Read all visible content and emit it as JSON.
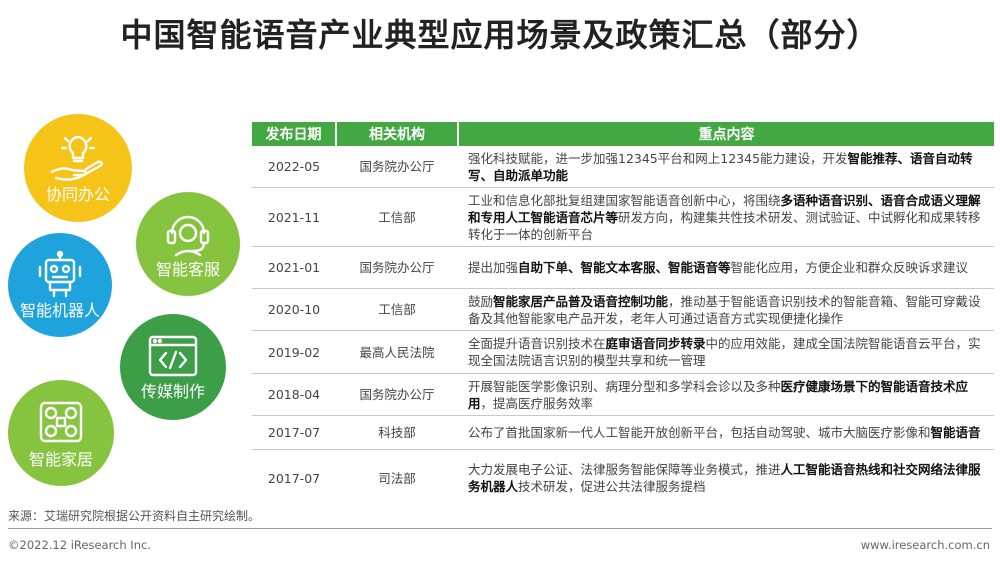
{
  "title": "中国智能语音产业典型应用场景及政策汇总（部分）",
  "scenarios": [
    {
      "label": "协同办公",
      "icon": "lightbulb-hand-icon",
      "color": "#f6c319"
    },
    {
      "label": "智能客服",
      "icon": "headset-agent-icon",
      "color": "#86c440"
    },
    {
      "label": "智能机器人",
      "icon": "robot-icon",
      "color": "#1fa3dc"
    },
    {
      "label": "传媒制作",
      "icon": "code-window-icon",
      "color": "#3c9e46"
    },
    {
      "label": "智能家居",
      "icon": "smart-home-icon",
      "color": "#86c440"
    }
  ],
  "table": {
    "headers": [
      "发布日期",
      "相关机构",
      "重点内容"
    ],
    "header_color": "#43a843",
    "rows": [
      {
        "date": "2022-05",
        "org": "国务院办公厅",
        "content": [
          [
            "强化科技赋能，进一步加强12345平台和网上12345能力建设，开发",
            false
          ],
          [
            "智能推荐、语音自动转写、自助派单功能",
            true
          ]
        ]
      },
      {
        "date": "2021-11",
        "org": "工信部",
        "content": [
          [
            "工业和信息化部批复组建国家智能语音创新中心，将围绕",
            false
          ],
          [
            "多语种语音识别、语音合成语义理解和专用人工智能语音芯片等",
            true
          ],
          [
            "研发方向，构建集共性技术研发、测试验证、中试孵化和成果转移转化于一体的创新平台",
            false
          ]
        ]
      },
      {
        "date": "2021-01",
        "org": "国务院办公厅",
        "content": [
          [
            "提出加强",
            false
          ],
          [
            "自助下单、智能文本客服、智能语音等",
            true
          ],
          [
            "智能化应用，方便企业和群众反映诉求建议",
            false
          ]
        ]
      },
      {
        "date": "2020-10",
        "org": "工信部",
        "content": [
          [
            "鼓励",
            false
          ],
          [
            "智能家居产品普及语音控制功能",
            true
          ],
          [
            "，推动基于智能语音识别技术的智能音箱、智能可穿戴设备及其他智能家电产品开发，老年人可通过语音方式实现便捷化操作",
            false
          ]
        ]
      },
      {
        "date": "2019-02",
        "org": "最高人民法院",
        "content": [
          [
            "全面提升语音识别技术在",
            false
          ],
          [
            "庭审语音同步转录",
            true
          ],
          [
            "中的应用效能，建成全国法院智能语音云平台，实现全国法院语言识别的模型共享和统一管理",
            false
          ]
        ]
      },
      {
        "date": "2018-04",
        "org": "国务院办公厅",
        "content": [
          [
            "开展智能医学影像识别、病理分型和多学科会诊以及多种",
            false
          ],
          [
            "医疗健康场景下的智能语音技术应用",
            true
          ],
          [
            "，提高医疗服务效率",
            false
          ]
        ]
      },
      {
        "date": "2017-07",
        "org": "科技部",
        "content": [
          [
            "公布了首批国家新一代人工智能开放创新平台，包括自动驾驶、城市大脑医疗影像和",
            false
          ],
          [
            "智能语音",
            true
          ]
        ]
      },
      {
        "date": "2017-07",
        "org": "司法部",
        "content": [
          [
            "大力发展电子公证、法律服务智能保障等业务模式，推进",
            false
          ],
          [
            "人工智能语音热线和社交网络法律服务机器人",
            true
          ],
          [
            "技术研发，促进公共法律服务提档",
            false
          ]
        ]
      }
    ]
  },
  "footer": {
    "source": "来源：艾瑞研究院根据公开资料自主研究绘制。",
    "copyright": "©2022.12 iResearch Inc.",
    "website": "www.iresearch.com.cn"
  }
}
